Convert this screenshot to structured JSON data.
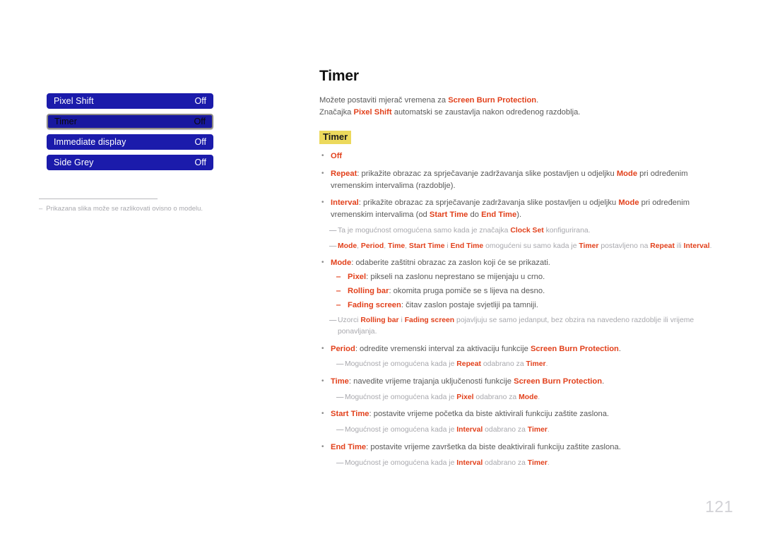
{
  "menu": {
    "rows": [
      {
        "label": "Pixel Shift",
        "value": "Off",
        "selected": false
      },
      {
        "label": "Timer",
        "value": "Off",
        "selected": true
      },
      {
        "label": "Immediate display",
        "value": "Off",
        "selected": false
      },
      {
        "label": "Side Grey",
        "value": "Off",
        "selected": false
      }
    ],
    "note_dash": "‒",
    "note": "Prikazana slika može se razlikovati ovisno o modelu."
  },
  "content": {
    "title": "Timer",
    "intro": [
      {
        "parts": [
          {
            "t": "Možete postaviti mjerač vremena za ",
            "s": "n"
          },
          {
            "t": "Screen Burn Protection",
            "s": "hl"
          },
          {
            "t": ".",
            "s": "n"
          }
        ]
      },
      {
        "parts": [
          {
            "t": "Značajka ",
            "s": "n"
          },
          {
            "t": "Pixel Shift",
            "s": "hl"
          },
          {
            "t": " automatski se zaustavlja nakon određenog razdoblja.",
            "s": "n"
          }
        ]
      }
    ],
    "section_heading": "Timer",
    "blocks": [
      {
        "kind": "bullet",
        "marker": "•",
        "parts": [
          {
            "t": "Off",
            "s": "hl"
          }
        ]
      },
      {
        "kind": "bullet",
        "marker": "•",
        "parts": [
          {
            "t": "Repeat",
            "s": "hl"
          },
          {
            "t": ": prikažite obrazac za sprječavanje zadržavanja slike postavljen u odjeljku ",
            "s": "n"
          },
          {
            "t": "Mode",
            "s": "hl"
          },
          {
            "t": " pri određenim vremenskim intervalima (razdoblje).",
            "s": "n"
          }
        ]
      },
      {
        "kind": "bullet",
        "marker": "•",
        "parts": [
          {
            "t": "Interval",
            "s": "hl"
          },
          {
            "t": ": prikažite obrazac za sprječavanje zadržavanja slike postavljen u odjeljku ",
            "s": "n"
          },
          {
            "t": "Mode",
            "s": "hl"
          },
          {
            "t": " pri određenim vremenskim intervalima (od ",
            "s": "n"
          },
          {
            "t": "Start Time",
            "s": "hl"
          },
          {
            "t": " do ",
            "s": "n"
          },
          {
            "t": "End Time",
            "s": "hl"
          },
          {
            "t": ").",
            "s": "n"
          }
        ]
      },
      {
        "kind": "note",
        "indent": "ind1",
        "marker": "—",
        "parts": [
          {
            "t": "Ta je mogućnost omogućena samo kada je značajka ",
            "s": "n"
          },
          {
            "t": "Clock Set",
            "s": "hl"
          },
          {
            "t": " konfigurirana.",
            "s": "n"
          }
        ]
      },
      {
        "kind": "note",
        "indent": "ind1",
        "marker": "—",
        "parts": [
          {
            "t": "Mode",
            "s": "hl"
          },
          {
            "t": ", ",
            "s": "n"
          },
          {
            "t": "Period",
            "s": "hl"
          },
          {
            "t": ", ",
            "s": "n"
          },
          {
            "t": "Time",
            "s": "hl"
          },
          {
            "t": ", ",
            "s": "n"
          },
          {
            "t": "Start Time",
            "s": "hl"
          },
          {
            "t": " i ",
            "s": "n"
          },
          {
            "t": "End Time",
            "s": "hl"
          },
          {
            "t": " omogućeni su samo kada je ",
            "s": "n"
          },
          {
            "t": "Timer",
            "s": "hl"
          },
          {
            "t": " postavljeno na ",
            "s": "n"
          },
          {
            "t": "Repeat",
            "s": "hl"
          },
          {
            "t": " ili ",
            "s": "n"
          },
          {
            "t": "Interval",
            "s": "hl"
          },
          {
            "t": ".",
            "s": "n"
          }
        ]
      },
      {
        "kind": "bullet",
        "marker": "•",
        "parts": [
          {
            "t": "Mode",
            "s": "hl"
          },
          {
            "t": ": odaberite zaštitni obrazac za zaslon koji će se prikazati.",
            "s": "n"
          }
        ]
      },
      {
        "kind": "subbullet",
        "marker": "‒",
        "parts": [
          {
            "t": "Pixel",
            "s": "hl"
          },
          {
            "t": ": pikseli na zaslonu neprestano se mijenjaju u crno.",
            "s": "n"
          }
        ]
      },
      {
        "kind": "subbullet",
        "marker": "‒",
        "parts": [
          {
            "t": "Rolling bar",
            "s": "hl"
          },
          {
            "t": ": okomita pruga pomiče se s lijeva na desno.",
            "s": "n"
          }
        ]
      },
      {
        "kind": "subbullet",
        "marker": "‒",
        "parts": [
          {
            "t": "Fading screen",
            "s": "hl"
          },
          {
            "t": ": čitav zaslon postaje svjetliji pa tamniji.",
            "s": "n"
          }
        ]
      },
      {
        "kind": "note",
        "indent": "ind1",
        "marker": "—",
        "parts": [
          {
            "t": "Uzorci ",
            "s": "n"
          },
          {
            "t": "Rolling bar",
            "s": "hl"
          },
          {
            "t": " i ",
            "s": "n"
          },
          {
            "t": "Fading screen",
            "s": "hl"
          },
          {
            "t": " pojavljuju se samo jedanput, bez obzira na navedeno razdoblje ili vrijeme ponavljanja.",
            "s": "n"
          }
        ]
      },
      {
        "kind": "bullet",
        "marker": "•",
        "parts": [
          {
            "t": "Period",
            "s": "hl"
          },
          {
            "t": ": odredite vremenski interval za aktivaciju funkcije ",
            "s": "n"
          },
          {
            "t": "Screen Burn Protection",
            "s": "hl"
          },
          {
            "t": ".",
            "s": "n"
          }
        ]
      },
      {
        "kind": "note",
        "indent": "ind2",
        "marker": "—",
        "parts": [
          {
            "t": "Mogućnost je omogućena kada je ",
            "s": "n"
          },
          {
            "t": "Repeat",
            "s": "hl"
          },
          {
            "t": " odabrano za ",
            "s": "n"
          },
          {
            "t": "Timer",
            "s": "hl"
          },
          {
            "t": ".",
            "s": "n"
          }
        ]
      },
      {
        "kind": "bullet",
        "marker": "•",
        "parts": [
          {
            "t": "Time",
            "s": "hl"
          },
          {
            "t": ": navedite vrijeme trajanja uključenosti funkcije ",
            "s": "n"
          },
          {
            "t": "Screen Burn Protection",
            "s": "hl"
          },
          {
            "t": ".",
            "s": "n"
          }
        ]
      },
      {
        "kind": "note",
        "indent": "ind2",
        "marker": "—",
        "parts": [
          {
            "t": "Mogućnost je omogućena kada je ",
            "s": "n"
          },
          {
            "t": "Pixel",
            "s": "hl"
          },
          {
            "t": " odabrano za ",
            "s": "n"
          },
          {
            "t": "Mode",
            "s": "hl"
          },
          {
            "t": ".",
            "s": "n"
          }
        ]
      },
      {
        "kind": "bullet",
        "marker": "•",
        "parts": [
          {
            "t": "Start Time",
            "s": "hl"
          },
          {
            "t": ": postavite vrijeme početka da biste aktivirali funkciju zaštite zaslona.",
            "s": "n"
          }
        ]
      },
      {
        "kind": "note",
        "indent": "ind2",
        "marker": "—",
        "parts": [
          {
            "t": "Mogućnost je omogućena kada je ",
            "s": "n"
          },
          {
            "t": "Interval",
            "s": "hl"
          },
          {
            "t": " odabrano za ",
            "s": "n"
          },
          {
            "t": "Timer",
            "s": "hl"
          },
          {
            "t": ".",
            "s": "n"
          }
        ]
      },
      {
        "kind": "bullet",
        "marker": "•",
        "parts": [
          {
            "t": "End Time",
            "s": "hl"
          },
          {
            "t": ": postavite vrijeme završetka da biste deaktivirali funkciju zaštite zaslona.",
            "s": "n"
          }
        ]
      },
      {
        "kind": "note",
        "indent": "ind2",
        "marker": "—",
        "parts": [
          {
            "t": "Mogućnost je omogućena kada je ",
            "s": "n"
          },
          {
            "t": "Interval",
            "s": "hl"
          },
          {
            "t": " odabrano za ",
            "s": "n"
          },
          {
            "t": "Timer",
            "s": "hl"
          },
          {
            "t": ".",
            "s": "n"
          }
        ]
      }
    ]
  },
  "page_number": "121",
  "colors": {
    "accent_red": "#e2411c",
    "menu_blue": "#1b1bab",
    "highlight_yellow": "#ecd95c",
    "body_grey": "#595959",
    "note_grey": "#a8a8ad"
  }
}
